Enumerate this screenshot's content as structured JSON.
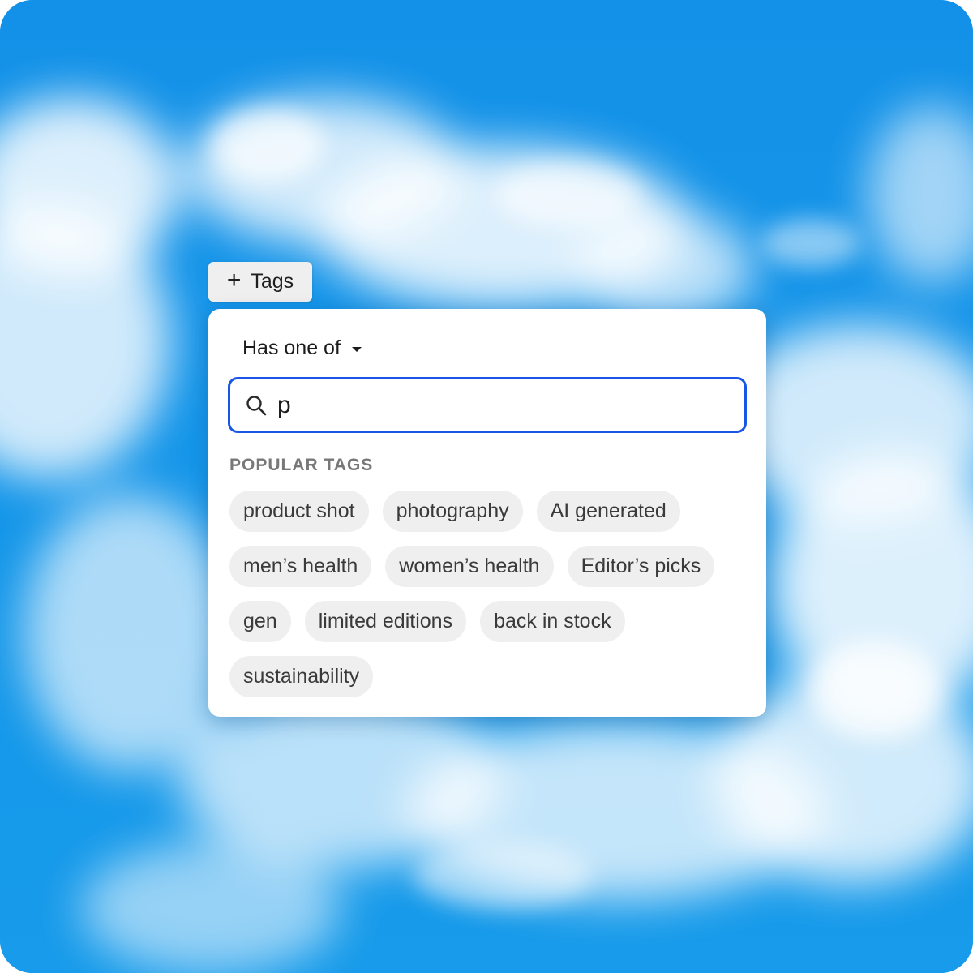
{
  "tags_button": {
    "icon": "plus-icon",
    "label": "Tags"
  },
  "filter_panel": {
    "operator": {
      "label": "Has one of",
      "icon": "caret-down-icon"
    },
    "search": {
      "icon": "search-icon",
      "value": "p",
      "focused_border_color": "#1a56e6"
    },
    "popular_tags": {
      "heading": "POPULAR TAGS",
      "tags": [
        "product shot",
        "photography",
        "AI generated",
        "men’s health",
        "women’s health",
        "Editor’s picks",
        "gen",
        "limited editions",
        "back in stock",
        "sustainability"
      ]
    }
  },
  "colors": {
    "sky": "#1496ea",
    "cloud": "#ffffff",
    "chip_background": "#efefef",
    "focus_accent": "#1a56e6"
  }
}
